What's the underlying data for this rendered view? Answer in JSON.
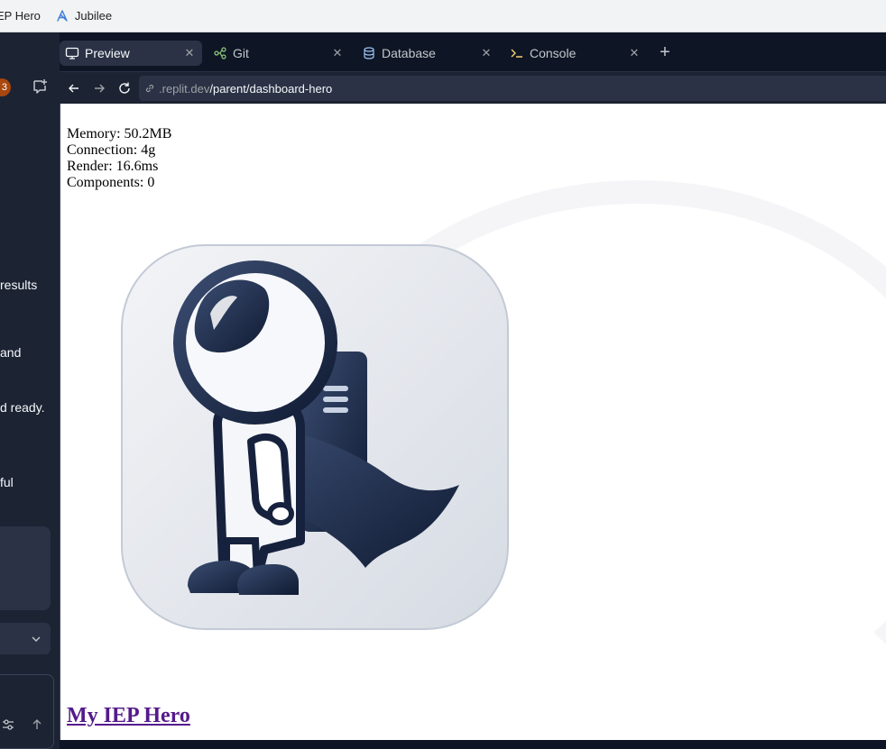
{
  "bookmarks": [
    {
      "label": "EP Hero",
      "icon": "link-icon"
    },
    {
      "label": "Jubilee",
      "icon": "jubilee-icon"
    }
  ],
  "left_panel": {
    "badge_count": "3",
    "message_fragments": [
      "results",
      "and",
      "d ready.",
      "ful"
    ]
  },
  "tabs": [
    {
      "label": "Preview",
      "icon": "monitor-icon",
      "active": true
    },
    {
      "label": "Git",
      "icon": "git-icon",
      "active": false
    },
    {
      "label": "Database",
      "icon": "database-icon",
      "active": false
    },
    {
      "label": "Console",
      "icon": "terminal-icon",
      "active": false
    }
  ],
  "url": {
    "host": ".replit.dev",
    "path": "/parent/dashboard-hero"
  },
  "metrics": {
    "memory": "Memory: 50.2MB",
    "connection": "Connection: 4g",
    "render": "Render: 16.6ms",
    "components": "Components: 0"
  },
  "page": {
    "title_link": "My IEP Hero"
  },
  "colors": {
    "ide_bg": "#0e1525",
    "panel_bg": "#1c2333",
    "tab_active": "#2b3245",
    "link_visited": "#551a8b",
    "hero_navy": "#1b2a4a"
  }
}
